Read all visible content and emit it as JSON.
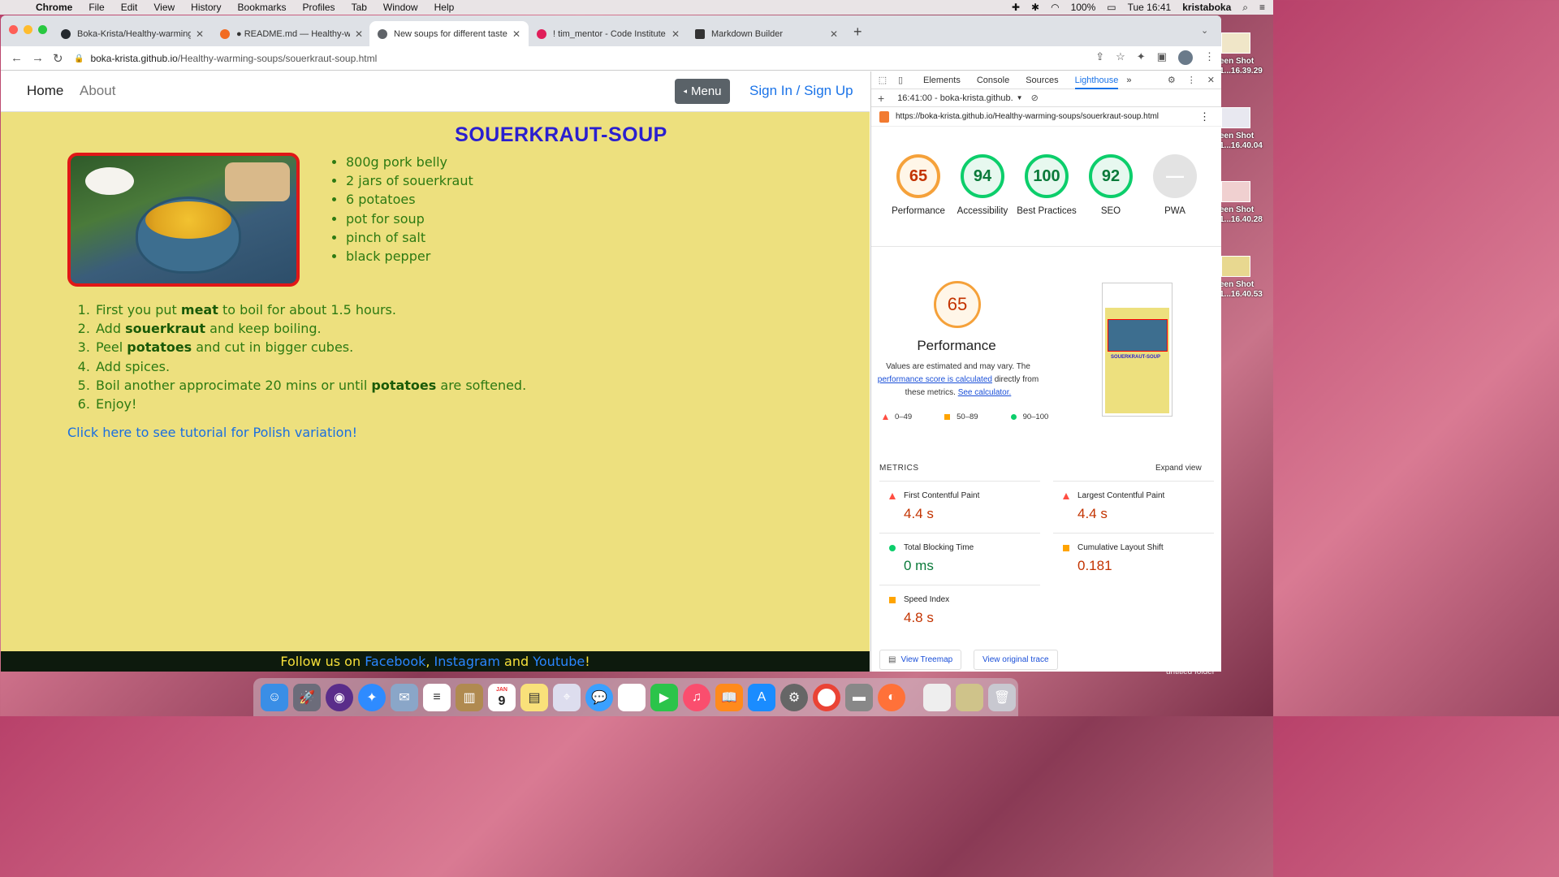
{
  "menubar": {
    "app": "Chrome",
    "items": [
      "File",
      "Edit",
      "View",
      "History",
      "Bookmarks",
      "Profiles",
      "Tab",
      "Window",
      "Help"
    ],
    "battery": "100%",
    "clock": "Tue 16:41",
    "user": "kristaboka"
  },
  "desktop": {
    "shots": [
      {
        "line1": "een Shot",
        "line2": "1...16.39.29"
      },
      {
        "line1": "een Shot",
        "line2": "1...16.40.04"
      },
      {
        "line1": "een Shot",
        "line2": "1...16.40.28"
      },
      {
        "line1": "een Shot",
        "line2": "1...16.40.53"
      }
    ],
    "folder": "untitled folder"
  },
  "browser": {
    "tabs": [
      {
        "title": "Boka-Krista/Healthy-warming-",
        "color": "#24292e"
      },
      {
        "title": "● README.md — Healthy-war",
        "color": "#f26b21"
      },
      {
        "title": "New soups for different tastes",
        "color": "#5f6368"
      },
      {
        "title": "! tim_mentor - Code Institute -",
        "color": "#e01e5a"
      },
      {
        "title": "Markdown Builder",
        "color": "#333333"
      }
    ],
    "url_host": "boka-krista.github.io",
    "url_path": "/Healthy-warming-soups/souerkraut-soup.html"
  },
  "site": {
    "nav_home": "Home",
    "nav_about": "About",
    "menu_label": "Menu",
    "signin": "Sign In / Sign Up",
    "title": "SOUERKRAUT-SOUP",
    "ingredients": [
      "800g pork belly",
      "2 jars of souerkraut",
      "6 potatoes",
      "pot for soup",
      "pinch of salt",
      "black pepper"
    ],
    "steps": [
      {
        "pre": "First you put ",
        "bold": "meat",
        "post": " to boil for about 1.5 hours."
      },
      {
        "pre": "Add ",
        "bold": "souerkraut",
        "post": " and keep boiling."
      },
      {
        "pre": "Peel ",
        "bold": "potatoes",
        "post": " and cut in bigger cubes."
      },
      {
        "pre": "Add spices.",
        "bold": "",
        "post": ""
      },
      {
        "pre": "Boil another approcimate 20 mins or until ",
        "bold": "potatoes",
        "post": " are softened."
      },
      {
        "pre": "Enjoy!",
        "bold": "",
        "post": ""
      }
    ],
    "tutorial_link": "Click here to see tutorial for Polish variation!",
    "footer": {
      "pre": "Follow us on ",
      "facebook": "Facebook",
      "sep1": ", ",
      "instagram": "Instagram",
      "sep2": " and ",
      "youtube": "Youtube",
      "post": "!"
    }
  },
  "devtools": {
    "tabs": [
      "Elements",
      "Console",
      "Sources",
      "Lighthouse"
    ],
    "active_tab": "Lighthouse",
    "report_label": "16:41:00 - boka-krista.github.",
    "report_url": "https://boka-krista.github.io/Healthy-warming-soups/souerkraut-soup.html",
    "scores": [
      {
        "label": "Performance",
        "value": "65",
        "color": "#f5a13a",
        "text": "#c33300"
      },
      {
        "label": "Accessibility",
        "value": "94",
        "color": "#0cce6b",
        "text": "#0a7a3a"
      },
      {
        "label": "Best Practices",
        "value": "100",
        "color": "#0cce6b",
        "text": "#0a7a3a"
      },
      {
        "label": "SEO",
        "value": "92",
        "color": "#0cce6b",
        "text": "#0a7a3a"
      },
      {
        "label": "PWA",
        "value": "",
        "color": "#cfcfcf",
        "text": "#888888"
      }
    ],
    "perf_score": "65",
    "perf_heading": "Performance",
    "perf_desc_1": "Values are estimated and may vary. The",
    "perf_link_1": "performance score is calculated",
    "perf_desc_2": " directly from these metrics. ",
    "perf_link_2": "See calculator.",
    "legend": [
      "0–49",
      "50–89",
      "90–100"
    ],
    "thumb_title": "SOUERKRAUT-SOUP",
    "metrics_heading": "METRICS",
    "expand": "Expand view",
    "metrics": [
      {
        "label": "First Contentful Paint",
        "value": "4.4 s",
        "status": "red"
      },
      {
        "label": "Largest Contentful Paint",
        "value": "4.4 s",
        "status": "red"
      },
      {
        "label": "Total Blocking Time",
        "value": "0 ms",
        "status": "green"
      },
      {
        "label": "Cumulative Layout Shift",
        "value": "0.181",
        "status": "orange"
      },
      {
        "label": "Speed Index",
        "value": "4.8 s",
        "status": "orange"
      }
    ],
    "btn_treemap": "View Treemap",
    "btn_trace": "View original trace"
  },
  "dock_calendar": {
    "month": "JAN",
    "day": "9"
  }
}
